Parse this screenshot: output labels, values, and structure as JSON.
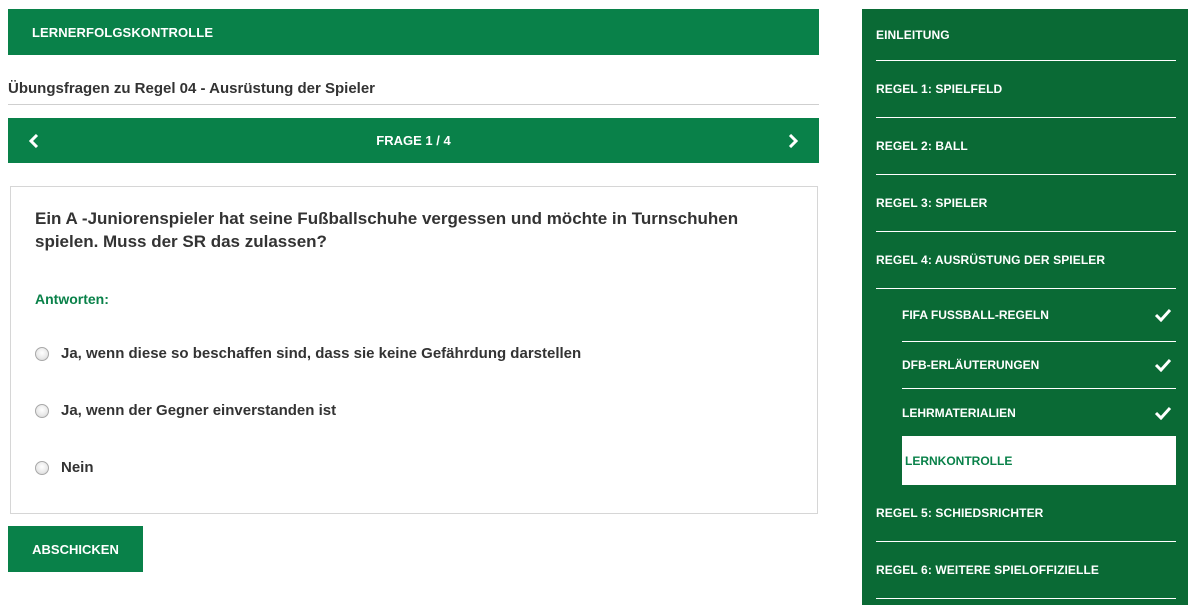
{
  "header": {
    "title": "LERNERFOLGSKONTROLLE"
  },
  "page": {
    "title": "Übungsfragen zu Regel 04 - Ausrüstung der Spieler"
  },
  "nav": {
    "label": "FRAGE 1 / 4"
  },
  "question": {
    "text": "Ein A -Juniorenspieler hat seine Fußballschuhe vergessen und möchte in Turnschuhen spielen. Muss der SR das zulassen?",
    "answers_label": "Antworten:",
    "answers": [
      "Ja, wenn diese so beschaffen sind, dass sie keine Gefährdung darstellen",
      "Ja, wenn der Gegner einverstanden ist",
      "Nein"
    ]
  },
  "submit": {
    "label": "ABSCHICKEN"
  },
  "sidebar": {
    "items": [
      {
        "label": "EINLEITUNG"
      },
      {
        "label": "REGEL 1: SPIELFELD"
      },
      {
        "label": "REGEL 2: BALL"
      },
      {
        "label": "REGEL 3: SPIELER"
      },
      {
        "label": "REGEL 4: AUSRÜSTUNG DER SPIELER"
      },
      {
        "label": "REGEL 5: SCHIEDSRICHTER"
      },
      {
        "label": "REGEL 6: WEITERE SPIELOFFIZIELLE"
      }
    ],
    "subitems": [
      {
        "label": "FIFA FUSSBALL-REGELN",
        "icon": "check-icon"
      },
      {
        "label": "DFB-ERLÄUTERUNGEN",
        "icon": "check-icon"
      },
      {
        "label": "LEHRMATERIALIEN",
        "icon": "check-icon"
      },
      {
        "label": "LERNKONTROLLE"
      }
    ]
  },
  "colors": {
    "primary": "#098149",
    "sidebar": "#0a6a35"
  }
}
